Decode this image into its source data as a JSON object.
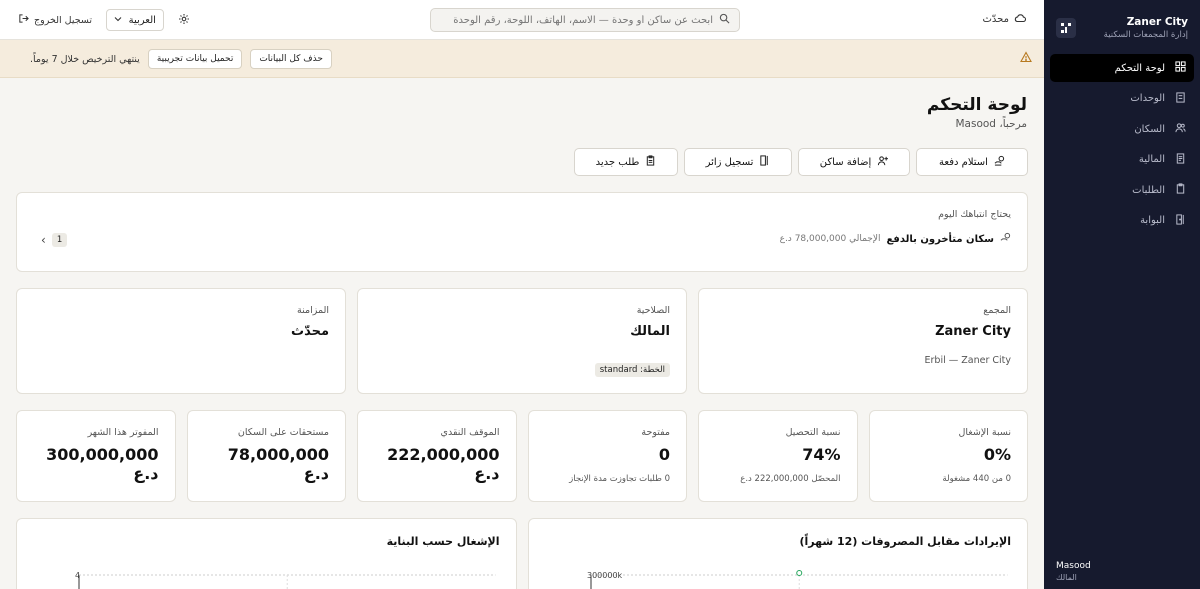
{
  "sidebar": {
    "brand_name": "Zaner City",
    "brand_subtitle": "إدارة المجمعات السكنية",
    "items": [
      {
        "label": "لوحة التحكم",
        "icon": "dashboard-icon",
        "active": true
      },
      {
        "label": "الوحدات",
        "icon": "building-icon",
        "active": false
      },
      {
        "label": "السكان",
        "icon": "users-icon",
        "active": false
      },
      {
        "label": "المالية",
        "icon": "receipt-icon",
        "active": false
      },
      {
        "label": "الطلبات",
        "icon": "clipboard-icon",
        "active": false
      },
      {
        "label": "البوابة",
        "icon": "gate-icon",
        "active": false
      }
    ],
    "user_name": "Masood",
    "user_role": "المالك"
  },
  "topbar": {
    "sync_status": "محدّث",
    "search_placeholder": "ابحث عن ساكن أو وحدة — الاسم، الهاتف، اللوحة، رقم الوحدة",
    "language": "العربية",
    "logout_label": "تسجيل الخروج"
  },
  "banner": {
    "message": "ينتهي الترخيص خلال 7 يوماً.",
    "load_demo_label": "تحميل بيانات تجريبية",
    "delete_all_label": "حذف كل البيانات"
  },
  "page": {
    "title": "لوحة التحكم",
    "greeting": "مرحباً، Masood"
  },
  "actions": [
    {
      "label": "استلام دفعة",
      "icon": "payment-icon"
    },
    {
      "label": "إضافة ساكن",
      "icon": "add-user-icon"
    },
    {
      "label": "تسجيل زائر",
      "icon": "visitor-icon"
    },
    {
      "label": "طلب جديد",
      "icon": "new-request-icon"
    }
  ],
  "attention": {
    "title": "يحتاج انتباهك اليوم",
    "item_label": "سكان متأخرون بالدفع",
    "item_detail": "الإجمالي 78,000,000 د.ع",
    "page": "1"
  },
  "info_cards": {
    "complex": {
      "label": "المجمع",
      "value": "Zaner City",
      "meta": "Erbil — Zaner City"
    },
    "role": {
      "label": "الصلاحية",
      "value": "المالك",
      "plan": "الخطة: standard"
    },
    "sync": {
      "label": "المزامنة",
      "value": "محدّث"
    }
  },
  "kpis": [
    {
      "label": "نسبة الإشغال",
      "value": "0%",
      "sub": "0 من 440 مشغولة"
    },
    {
      "label": "نسبة التحصيل",
      "value": "74%",
      "sub": "المحصّل 222,000,000 د.ع"
    },
    {
      "label": "مفتوحة",
      "value": "0",
      "sub": "0 طلبات تجاوزت مدة الإنجاز"
    },
    {
      "label": "الموقف النقدي",
      "value": "222,000,000 د.ع",
      "sub": ""
    },
    {
      "label": "مستحقات على السكان",
      "value": "78,000,000 د.ع",
      "sub": ""
    },
    {
      "label": "المفوتر هذا الشهر",
      "value": "300,000,000 د.ع",
      "sub": ""
    }
  ],
  "charts": {
    "revenue_title": "الإيرادات مقابل المصروفات (12 شهراً)",
    "occupancy_title": "الإشغال حسب البناية"
  },
  "chart_data": [
    {
      "type": "line",
      "title": "الإيرادات مقابل المصروفات (12 شهراً)",
      "y_tick_labels": [
        "300000k"
      ],
      "ylim": [
        0,
        300000
      ],
      "series": [
        {
          "values": [
            300000
          ]
        }
      ]
    },
    {
      "type": "bar",
      "title": "الإشغال حسب البناية",
      "y_tick_labels": [
        "4"
      ],
      "ylim": [
        0,
        4
      ]
    }
  ],
  "colors": {
    "sidebar_bg": "#161a2e",
    "banner_bg": "#f5ecdd",
    "page_bg": "#f6f5f2",
    "accent_point": "#22a55a"
  }
}
